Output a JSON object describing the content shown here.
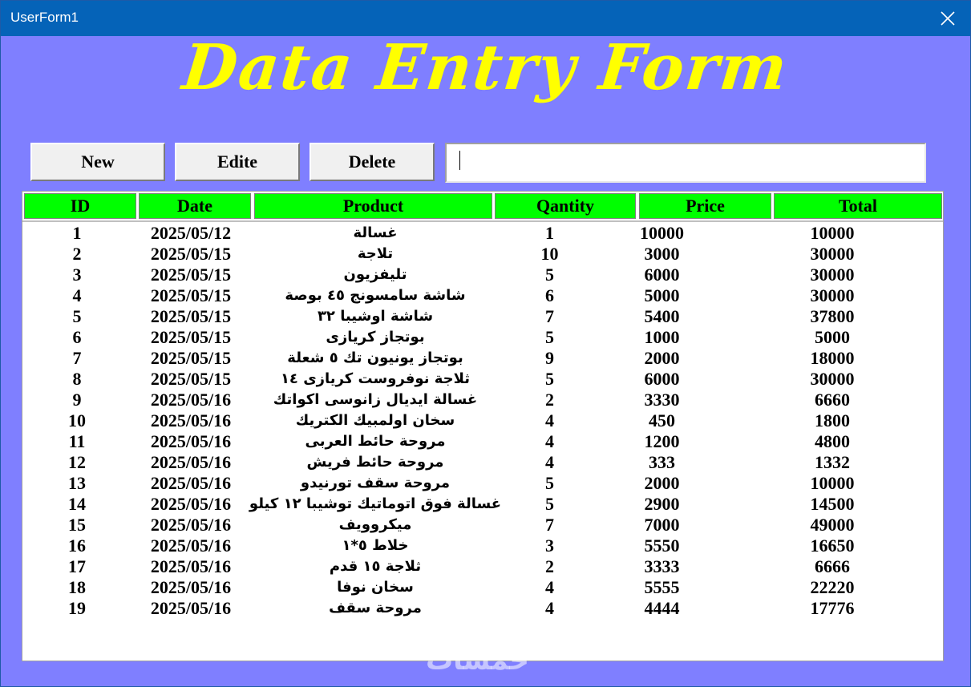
{
  "window": {
    "title": "UserForm1",
    "close_icon": "close-icon"
  },
  "banner": {
    "text": "Data Entry Form",
    "color": "#ffff00"
  },
  "toolbar": {
    "new_label": "New",
    "edit_label": "Edite",
    "delete_label": "Delete",
    "search_value": ""
  },
  "table": {
    "headers": [
      "ID",
      "Date",
      "Product",
      "Qantity",
      "Price",
      "Total"
    ],
    "header_color": "#00ff00",
    "rows": [
      [
        "1",
        "2025/05/12",
        "غسالة",
        "1",
        "10000",
        "10000"
      ],
      [
        "2",
        "2025/05/15",
        "تلاجة",
        "10",
        "3000",
        "30000"
      ],
      [
        "3",
        "2025/05/15",
        "تليفزيون",
        "5",
        "6000",
        "30000"
      ],
      [
        "4",
        "2025/05/15",
        "شاشة سامسونج ٤٥ بوصة",
        "6",
        "5000",
        "30000"
      ],
      [
        "5",
        "2025/05/15",
        "شاشة اوشيبا ٣٢",
        "7",
        "5400",
        "37800"
      ],
      [
        "6",
        "2025/05/15",
        "بوتجاز كريازى",
        "5",
        "1000",
        "5000"
      ],
      [
        "7",
        "2025/05/15",
        "بوتجاز يونيون تك ٥ شعلة",
        "9",
        "2000",
        "18000"
      ],
      [
        "8",
        "2025/05/15",
        "ثلاجة نوفروست كريازى ١٤",
        "5",
        "6000",
        "30000"
      ],
      [
        "9",
        "2025/05/16",
        "غسالة ايديال زانوسى اكواتك",
        "2",
        "3330",
        "6660"
      ],
      [
        "10",
        "2025/05/16",
        "سخان اولمبيك الكتريك",
        "4",
        "450",
        "1800"
      ],
      [
        "11",
        "2025/05/16",
        "مروحة حائط العربى",
        "4",
        "1200",
        "4800"
      ],
      [
        "12",
        "2025/05/16",
        "مروحة حائط فريش",
        "4",
        "333",
        "1332"
      ],
      [
        "13",
        "2025/05/16",
        "مروحة سقف تورنيدو",
        "5",
        "2000",
        "10000"
      ],
      [
        "14",
        "2025/05/16",
        "غسالة فوق اتوماتيك توشيبا ١٢ كيلو",
        "5",
        "2900",
        "14500"
      ],
      [
        "15",
        "2025/05/16",
        "ميكروويف",
        "7",
        "7000",
        "49000"
      ],
      [
        "16",
        "2025/05/16",
        "خلاط ٥*١",
        "3",
        "5550",
        "16650"
      ],
      [
        "17",
        "2025/05/16",
        "ثلاجة ١٥ قدم",
        "2",
        "3333",
        "6666"
      ],
      [
        "18",
        "2025/05/16",
        "سخان نوفا",
        "4",
        "5555",
        "22220"
      ],
      [
        "19",
        "2025/05/16",
        "مروحة سقف",
        "4",
        "4444",
        "17776"
      ]
    ]
  },
  "watermark": {
    "text": "خمسات"
  }
}
